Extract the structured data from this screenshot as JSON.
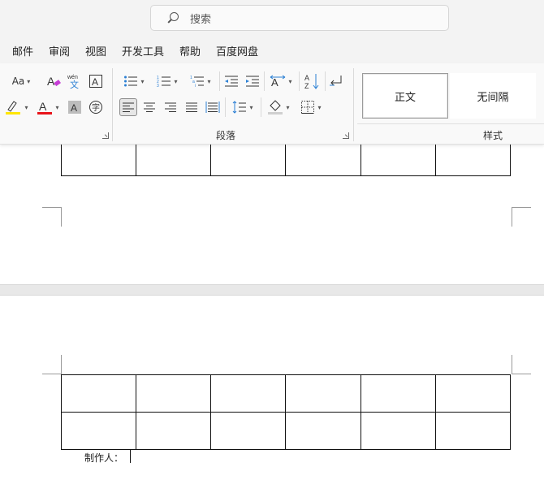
{
  "search": {
    "placeholder": "搜索"
  },
  "menu": {
    "tabs": [
      "邮件",
      "审阅",
      "视图",
      "开发工具",
      "帮助",
      "百度网盘"
    ]
  },
  "ribbon": {
    "font": {
      "change_case": "Aa"
    },
    "paragraph": {
      "label": "段落"
    },
    "styles": {
      "label": "样式",
      "items": [
        "正文",
        "无间隔"
      ]
    }
  },
  "document": {
    "caption": "制作人："
  },
  "colors": {
    "highlight": "#ffe600",
    "font_color": "#e8141a"
  }
}
